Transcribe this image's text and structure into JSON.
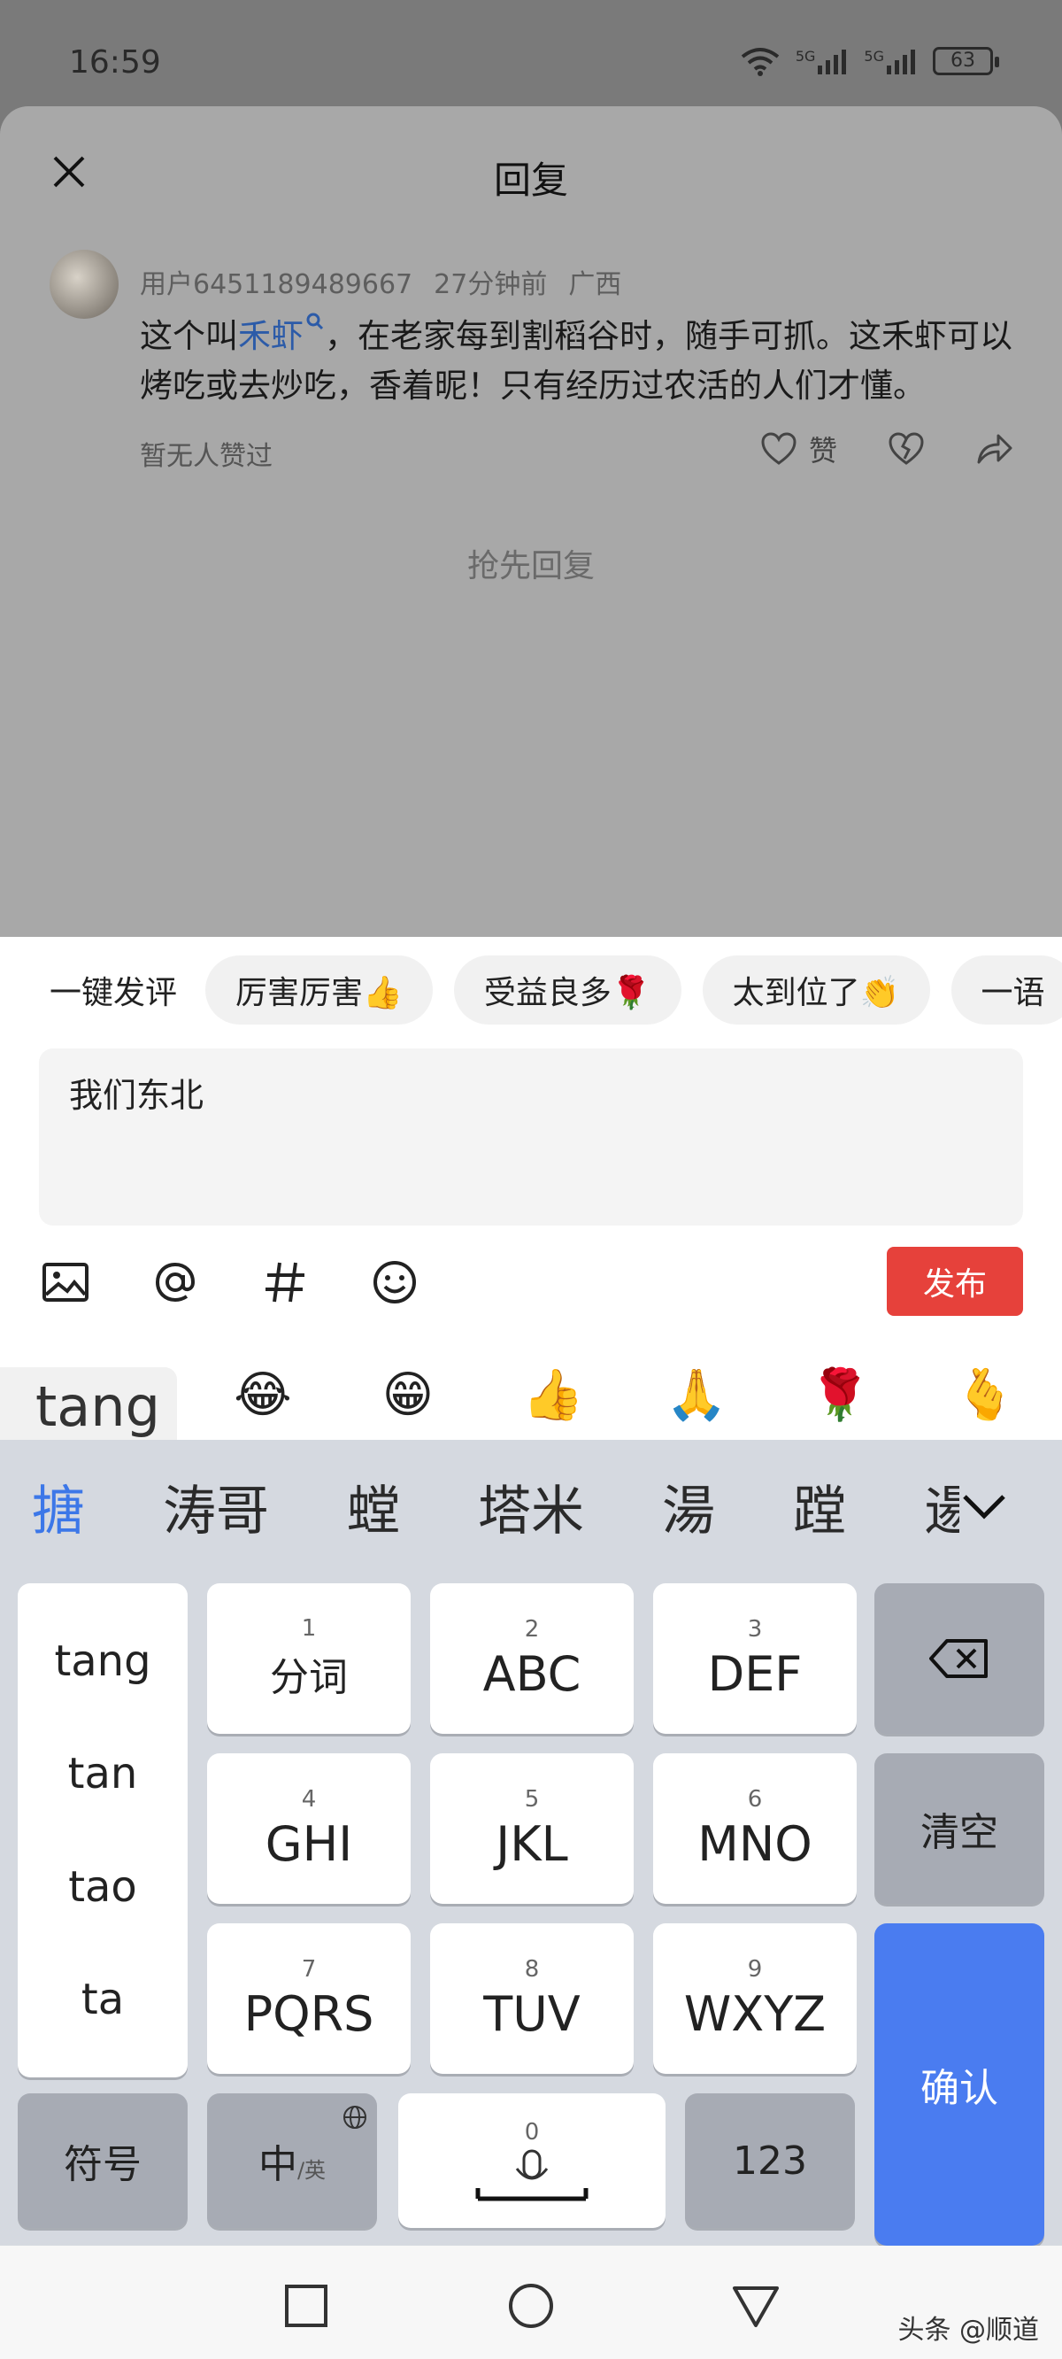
{
  "status_bar": {
    "time": "16:59",
    "network1": "5G",
    "network2": "5G",
    "battery": "63"
  },
  "sheet": {
    "title": "回复",
    "comment": {
      "user": "用户6451189489667",
      "time_ago": "27分钟前",
      "location": "广西",
      "text_before": "这个叫",
      "link_word": "禾虾",
      "text_after": "，在老家每到割稻谷时，随手可抓。这禾虾可以烤吃或去炒吃，香着昵！只有经历过农活的人们才懂。",
      "no_likes": "暂无人赞过",
      "like_label": "赞"
    },
    "first_reply": "抢先回复"
  },
  "composer": {
    "quick_label": "一键发评",
    "chips": [
      "厉害厉害👍",
      "受益良多🌹",
      "太到位了👏",
      "一语"
    ],
    "input_value": "我们东北",
    "publish_label": "发布",
    "emojis": [
      "😂",
      "😁",
      "👍",
      "🙏",
      "🌹",
      "🫰"
    ]
  },
  "keyboard": {
    "pinyin_input": "tang",
    "candidates": [
      "搪",
      "涛哥",
      "螳",
      "塔米",
      "湯",
      "蹚",
      "逿"
    ],
    "pinyin_options": [
      "tang",
      "tan",
      "tao",
      "ta"
    ],
    "keys": {
      "k1": {
        "num": "1",
        "label": "分词"
      },
      "k2": {
        "num": "2",
        "label": "ABC"
      },
      "k3": {
        "num": "3",
        "label": "DEF"
      },
      "k4": {
        "num": "4",
        "label": "GHI"
      },
      "k5": {
        "num": "5",
        "label": "JKL"
      },
      "k6": {
        "num": "6",
        "label": "MNO"
      },
      "k7": {
        "num": "7",
        "label": "PQRS"
      },
      "k8": {
        "num": "8",
        "label": "TUV"
      },
      "k9": {
        "num": "9",
        "label": "WXYZ"
      },
      "k0": {
        "num": "0"
      },
      "clear": "清空",
      "confirm": "确认",
      "symbols": "符号",
      "lang": "中",
      "lang_sub": "/英",
      "numbers": "123"
    }
  },
  "watermark": "头条 @顺道"
}
